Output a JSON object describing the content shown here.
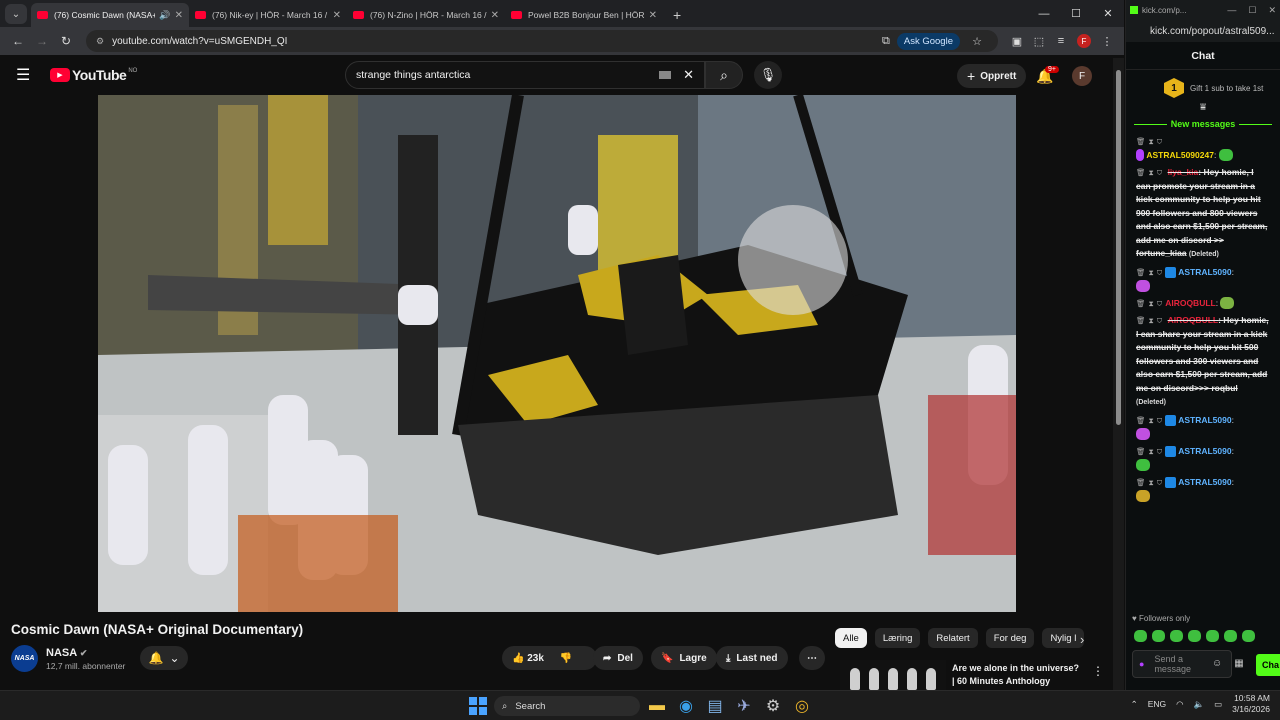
{
  "browser": {
    "tabs": [
      {
        "title": "(76) Cosmic Dawn (NASA+",
        "active": true
      },
      {
        "title": "(76) Nik-ey | HÖR - March 16 /",
        "active": false
      },
      {
        "title": "(76) N-Zino | HÖR - March 16 /",
        "active": false
      },
      {
        "title": "Powel B2B Bonjour Ben | HÖR -",
        "active": false
      }
    ],
    "url": "youtube.com/watch?v=uSMGENDH_QI",
    "ask_google": "Ask Google",
    "profile_initial": "F"
  },
  "youtube": {
    "logo": "YouTube",
    "region": "NO",
    "search_value": "strange things antarctica",
    "create_label": "Opprett",
    "notif_badge": "9+",
    "avatar_initial": "F",
    "video_title": "Cosmic Dawn (NASA+ Original Documentary)",
    "channel": {
      "name": "NASA",
      "subscribers": "12,7 mill. abonnenter",
      "avatar_text": "NASA"
    },
    "actions": {
      "likes": "23k",
      "share": "Del",
      "save": "Lagre",
      "download": "Last ned"
    },
    "chips": [
      "Alle",
      "Læring",
      "Relatert",
      "For deg",
      "Nylig l"
    ],
    "recommended": {
      "title": "Are we alone in the universe? | 60 Minutes Anthology"
    }
  },
  "chat": {
    "window_url_short": "kick.com/p...",
    "url": "kick.com/popout/astral509...",
    "title": "Chat",
    "gift_count": "1",
    "gift_text": "Gift 1 sub to take 1st",
    "new_messages": "New messages",
    "messages": [
      {
        "user": "ASTRAL5090247",
        "color": "#f5d90a",
        "text": ""
      },
      {
        "user": "liya_kia",
        "color": "#e8243c",
        "text": "Hey homie, I can promote your stream in a kick community to help you hit 900 followers and 800 viewers and also earn $1,500 per stream, add me on discord >> fortune_kiaa",
        "deleted": "(Deleted)"
      },
      {
        "user": "ASTRAL5090",
        "color": "#5fb3ff",
        "text": ""
      },
      {
        "user": "AIROQBULL",
        "color": "#e8243c",
        "text": ""
      },
      {
        "user": "AIROQBULL",
        "color": "#e8243c",
        "text": "Hey homie, I can share your stream in a kick community to help you hit 500 followers and 300 viewers and also earn $1,500 per stream, add me on discord>>> roqbul",
        "deleted": "(Deleted)"
      },
      {
        "user": "ASTRAL5090",
        "color": "#5fb3ff",
        "text": ""
      },
      {
        "user": "ASTRAL5090",
        "color": "#5fb3ff",
        "text": ""
      },
      {
        "user": "ASTRAL5090",
        "color": "#5fb3ff",
        "text": ""
      }
    ],
    "followers_only": "Followers only",
    "input_placeholder": "Send a message",
    "send": "Cha"
  },
  "taskbar": {
    "search": "Search",
    "lang": "ENG",
    "time": "10:58 AM",
    "date": "3/16/2026"
  }
}
